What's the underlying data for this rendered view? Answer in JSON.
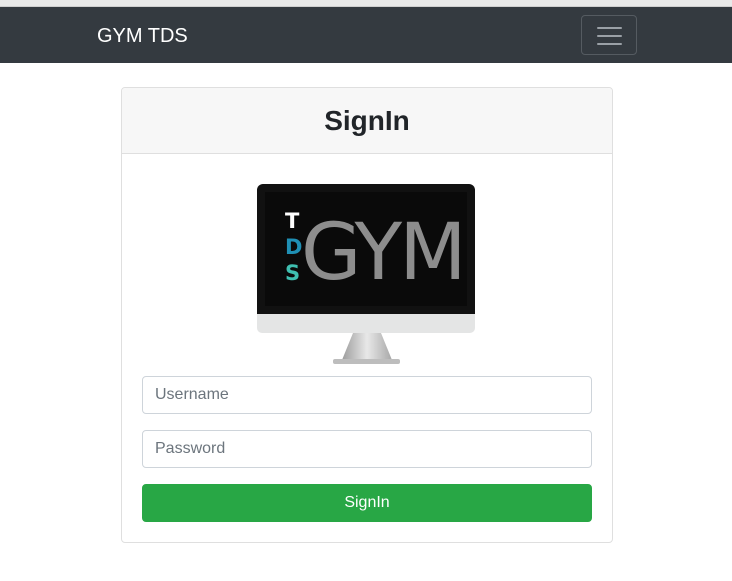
{
  "navbar": {
    "brand": "GYM TDS",
    "toggler_icon": "hamburger-icon"
  },
  "card": {
    "title": "SignIn"
  },
  "logo": {
    "letters_vertical": [
      "T",
      "D",
      "S"
    ],
    "wordmark": "GYM",
    "colors": {
      "T": "#ffffff",
      "D": "#1f8fb4",
      "S": "#3fbfb0",
      "wordmark": "#8d8d8d"
    }
  },
  "form": {
    "username_placeholder": "Username",
    "username_value": "",
    "password_placeholder": "Password",
    "password_value": "",
    "submit_label": "SignIn"
  },
  "colors": {
    "navbar_bg": "#343a40",
    "button_bg": "#28a745"
  }
}
